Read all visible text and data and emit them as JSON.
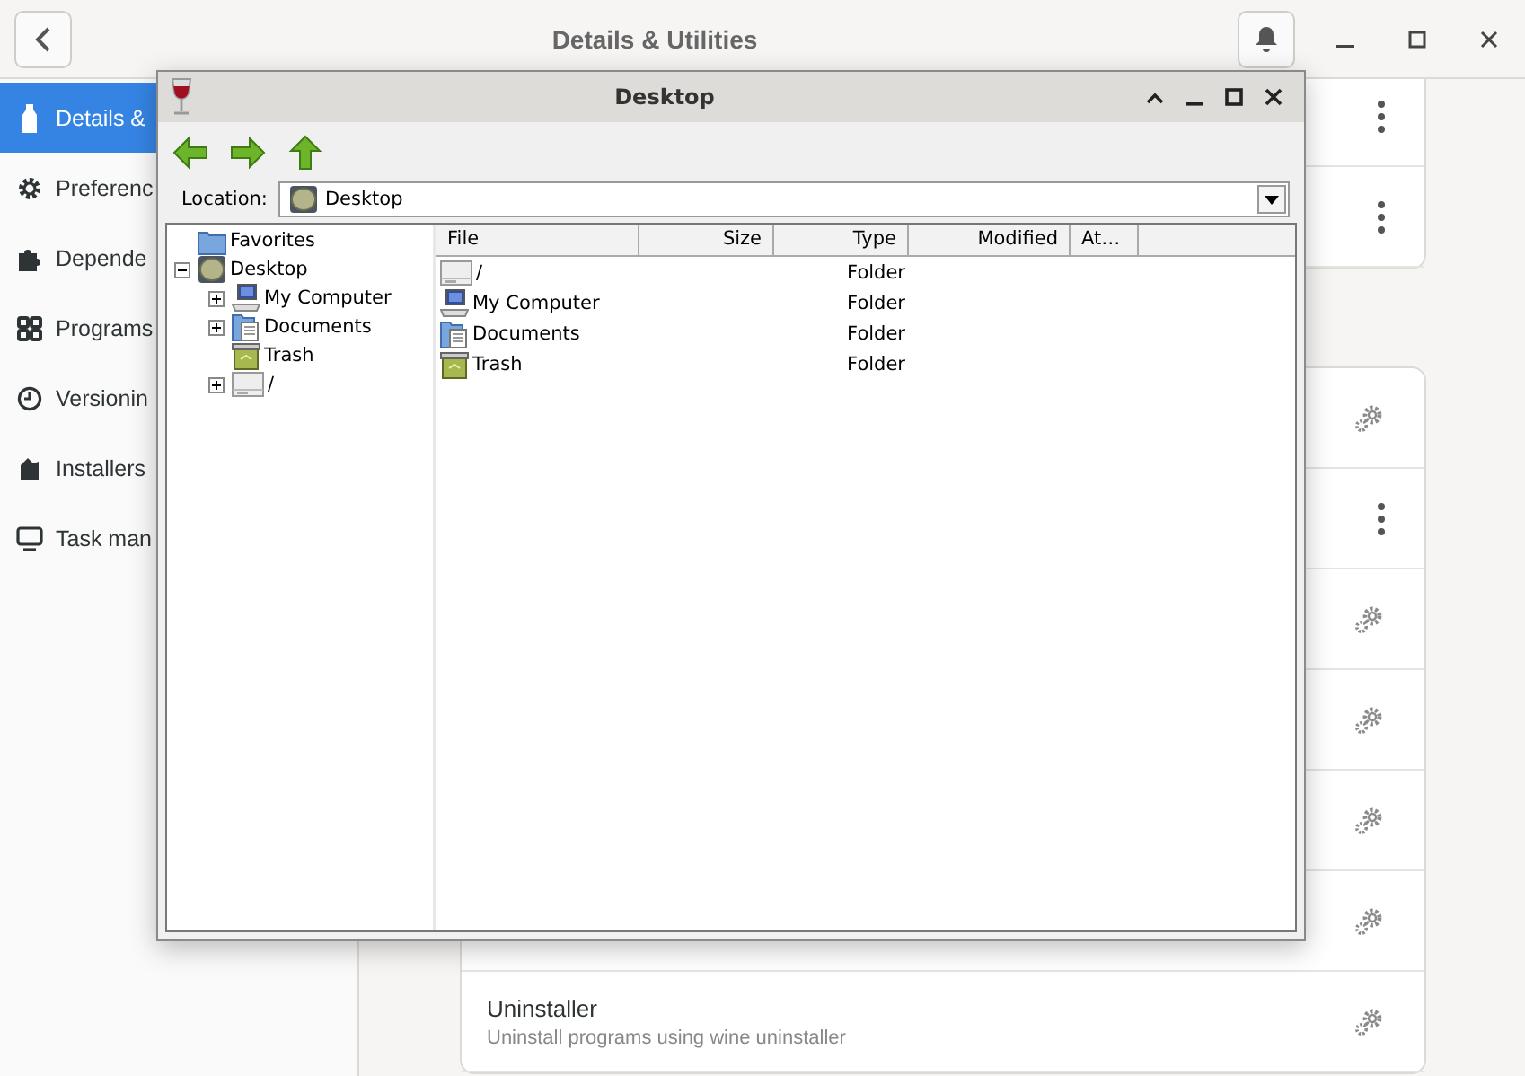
{
  "app": {
    "title": "Details & Utilities",
    "sidebar": [
      {
        "label": "Details &",
        "selected": true
      },
      {
        "label": "Preferenc",
        "selected": false
      },
      {
        "label": "Depende",
        "selected": false
      },
      {
        "label": "Programs",
        "selected": false
      },
      {
        "label": "Versionin",
        "selected": false
      },
      {
        "label": "Installers",
        "selected": false
      },
      {
        "label": "Task man",
        "selected": false
      }
    ],
    "top_card": [
      {
        "kind": "menu"
      },
      {
        "kind": "menu"
      }
    ],
    "tools_card": [
      {
        "kind": "gear"
      },
      {
        "kind": "menu"
      },
      {
        "kind": "gear"
      },
      {
        "kind": "gear"
      },
      {
        "kind": "gear"
      },
      {
        "kind": "gear"
      },
      {
        "kind": "gear",
        "title": "Uninstaller",
        "subtitle": "Uninstall programs using wine uninstaller"
      }
    ]
  },
  "dialog": {
    "title": "Desktop",
    "location_label": "Location:",
    "location": "Desktop",
    "tree": [
      {
        "label": "Favorites",
        "kind": "favorites"
      },
      {
        "label": "Desktop",
        "kind": "desktop",
        "expanded": true,
        "children": [
          {
            "label": "My Computer",
            "kind": "computer",
            "expanded": false
          },
          {
            "label": "Documents",
            "kind": "documents",
            "expanded": false
          },
          {
            "label": "Trash",
            "kind": "trash"
          },
          {
            "label": "/",
            "kind": "drive",
            "expanded": false
          }
        ]
      }
    ],
    "columns": [
      {
        "label": "File"
      },
      {
        "label": "Size"
      },
      {
        "label": "Type"
      },
      {
        "label": "Modified"
      },
      {
        "label": "At…"
      }
    ],
    "rows": [
      {
        "file": "/",
        "kind": "drive",
        "type": "Folder"
      },
      {
        "file": "My Computer",
        "kind": "computer",
        "type": "Folder"
      },
      {
        "file": "Documents",
        "kind": "documents",
        "type": "Folder"
      },
      {
        "file": "Trash",
        "kind": "trash",
        "type": "Folder"
      }
    ]
  }
}
